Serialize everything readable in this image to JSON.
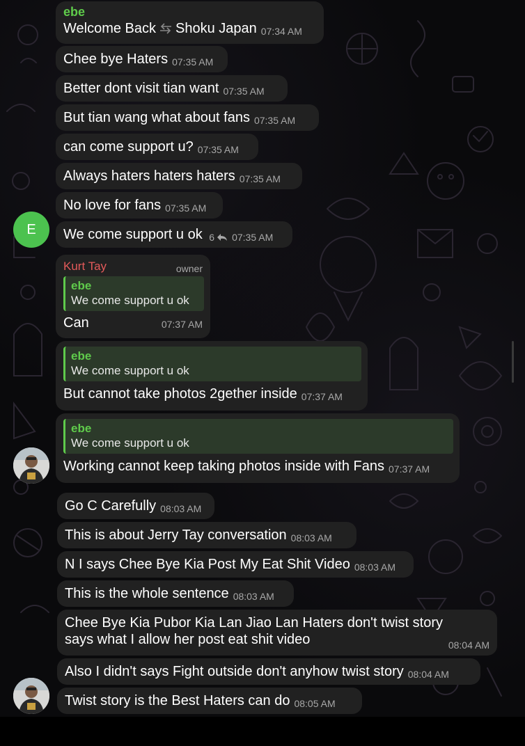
{
  "messages": [
    {
      "sender": "ebe",
      "text": "Welcome Back",
      "text2": "Shoku Japan",
      "time": "07:34 AM",
      "icon": "back-arrow-icon"
    },
    {
      "text": "Chee bye Haters",
      "time": "07:35 AM"
    },
    {
      "text": "Better dont visit tian want",
      "time": "07:35 AM"
    },
    {
      "text": "But tian wang what about fans",
      "time": "07:35 AM"
    },
    {
      "text": "can come support u?",
      "time": "07:35 AM"
    },
    {
      "text": "Always haters haters haters",
      "time": "07:35 AM"
    },
    {
      "text": "No love for fans",
      "time": "07:35 AM"
    },
    {
      "text": "We come support u ok",
      "replies": "6",
      "time": "07:35 AM"
    }
  ],
  "avatar_e_letter": "E",
  "owner_reply": {
    "sender": "Kurt Tay",
    "role": "owner",
    "quote_name": "ebe",
    "quote_text": "We come support u ok",
    "text": "Can",
    "time": "07:37 AM"
  },
  "reply2": {
    "quote_name": "ebe",
    "quote_text": "We come support u ok",
    "text": "But cannot take photos 2gether inside",
    "time": "07:37 AM"
  },
  "reply3": {
    "quote_name": "ebe",
    "quote_text": "We come support u ok",
    "text": "Working cannot keep taking photos inside with Fans",
    "time": "07:37 AM"
  },
  "later_messages": [
    {
      "text": "Go C Carefully",
      "time": "08:03 AM"
    },
    {
      "text": "This is about Jerry Tay conversation",
      "time": "08:03 AM"
    },
    {
      "text": "N I says Chee Bye Kia Post My Eat Shit Video",
      "time": "08:03 AM"
    },
    {
      "text": "This is the whole sentence",
      "time": "08:03 AM"
    },
    {
      "text_line1": "Chee Bye Kia Pubor Kia Lan Jiao Lan Haters don't twist story",
      "text_line2": "says what I allow her post eat shit video",
      "time": "08:04 AM"
    },
    {
      "text": "Also I didn't says Fight outside don't anyhow twist story",
      "time": "08:04 AM"
    },
    {
      "text": "Twist story is the Best Haters can do",
      "time": "08:05 AM"
    }
  ],
  "colors": {
    "bubble": "#212121",
    "sender_green": "#5fcb4b",
    "sender_red": "#e35a5a",
    "timestamp": "#a8a8a8",
    "avatar_green": "#4cc24f"
  }
}
